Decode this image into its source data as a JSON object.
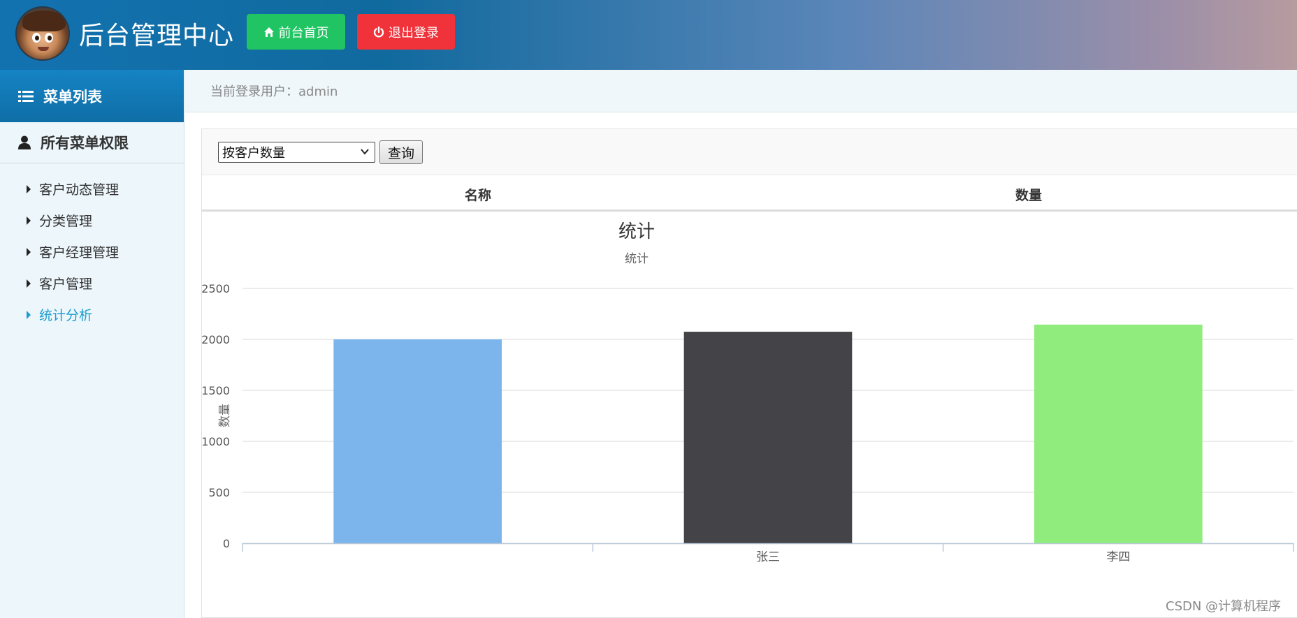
{
  "header": {
    "app_title": "后台管理中心",
    "home_button": "前台首页",
    "logout_button": "退出登录",
    "home_icon": "home-icon",
    "logout_icon": "power-icon"
  },
  "sidebar": {
    "menu_title": "菜单列表",
    "menu_icon": "list-icon",
    "group_title": "所有菜单权限",
    "group_icon": "user-icon",
    "items": [
      {
        "label": "客户动态管理"
      },
      {
        "label": "分类管理"
      },
      {
        "label": "客户经理管理"
      },
      {
        "label": "客户管理"
      },
      {
        "label": "统计分析",
        "active": true
      }
    ]
  },
  "userbar": {
    "text": "当前登录用户：admin"
  },
  "toolbar": {
    "select_value": "按客户数量",
    "query_label": "查询"
  },
  "table": {
    "columns": [
      "名称",
      "数量"
    ]
  },
  "chart_data": {
    "type": "bar",
    "title": "统计",
    "subtitle": "统计",
    "ylabel": "数量",
    "xlabel": "",
    "ylim": [
      0,
      2500
    ],
    "yticks": [
      0,
      500,
      1000,
      1500,
      2000,
      2500
    ],
    "categories": [
      "",
      "张三",
      "李四"
    ],
    "values": [
      2000,
      2075,
      2145
    ],
    "colors": [
      "#7cb5ec",
      "#434348",
      "#90ed7d"
    ],
    "grid": true
  },
  "watermark": "CSDN @计算机程序"
}
